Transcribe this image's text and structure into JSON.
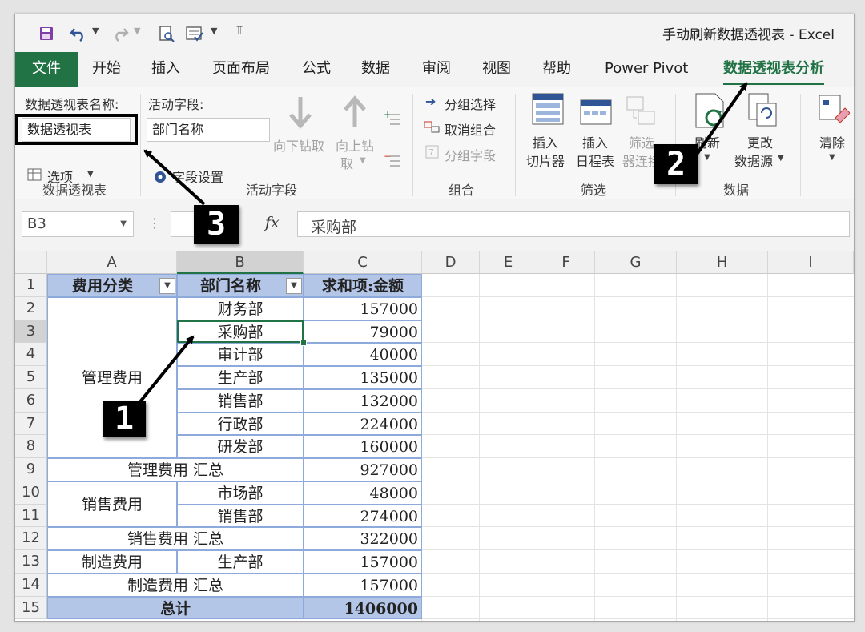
{
  "window": {
    "title": "手动刷新数据透视表  -  Excel"
  },
  "qat": {
    "save_icon": "save-icon",
    "undo_icon": "undo-icon",
    "redo_icon": "redo-icon"
  },
  "tabs": [
    {
      "label": "文件"
    },
    {
      "label": "开始"
    },
    {
      "label": "插入"
    },
    {
      "label": "页面布局"
    },
    {
      "label": "公式"
    },
    {
      "label": "数据"
    },
    {
      "label": "审阅"
    },
    {
      "label": "视图"
    },
    {
      "label": "帮助"
    },
    {
      "label": "Power Pivot"
    },
    {
      "label": "数据透视表分析"
    }
  ],
  "ribbon": {
    "pivot_name_label": "数据透视表名称:",
    "pivot_name_value": "数据透视表",
    "options_label": "选项",
    "group_pivot": "数据透视表",
    "active_field_label": "活动字段:",
    "active_field_value": "部门名称",
    "field_settings": "字段设置",
    "drill_down": "向下钻取",
    "drill_up_1": "向上钻",
    "drill_up_2": "取",
    "group_active_field": "活动字段",
    "group_selection": "分组选择",
    "ungroup": "取消组合",
    "group_field": "分组字段",
    "group_group": "组合",
    "insert_slicer_1": "插入",
    "insert_slicer_2": "切片器",
    "insert_timeline_1": "插入",
    "insert_timeline_2": "日程表",
    "filter_conn_1": "筛选",
    "filter_conn_2": "器连接",
    "group_filter": "筛选",
    "refresh": "刷新",
    "change_source_1": "更改",
    "change_source_2": "数据源",
    "group_data": "数据",
    "clear": "清除"
  },
  "formula_bar": {
    "name_box": "B3",
    "fx": "fx",
    "content": "采购部"
  },
  "columns": [
    "A",
    "B",
    "C",
    "D",
    "E",
    "F",
    "G",
    "H",
    "I"
  ],
  "rows": [
    "1",
    "2",
    "3",
    "4",
    "5",
    "6",
    "7",
    "8",
    "9",
    "10",
    "11",
    "12",
    "13",
    "14",
    "15"
  ],
  "table": {
    "header": {
      "a": "费用分类",
      "b": "部门名称",
      "c": "求和项:金额"
    },
    "group1": {
      "name": "管理费用",
      "depts": [
        "财务部",
        "采购部",
        "审计部",
        "生产部",
        "销售部",
        "行政部",
        "研发部"
      ],
      "values": [
        "157000",
        "79000",
        "40000",
        "135000",
        "132000",
        "224000",
        "160000"
      ],
      "subtotal_label": "管理费用  汇总",
      "subtotal": "927000"
    },
    "group2": {
      "name": "销售费用",
      "depts": [
        "市场部",
        "销售部"
      ],
      "values": [
        "48000",
        "274000"
      ],
      "subtotal_label": "销售费用  汇总",
      "subtotal": "322000"
    },
    "group3": {
      "name": "制造费用",
      "depts": [
        "生产部"
      ],
      "values": [
        "157000"
      ],
      "subtotal_label": "制造费用  汇总",
      "subtotal": "157000"
    },
    "total_label": "总计",
    "total": "1406000"
  },
  "markers": {
    "m1": "1",
    "m2": "2",
    "m3": "3"
  }
}
